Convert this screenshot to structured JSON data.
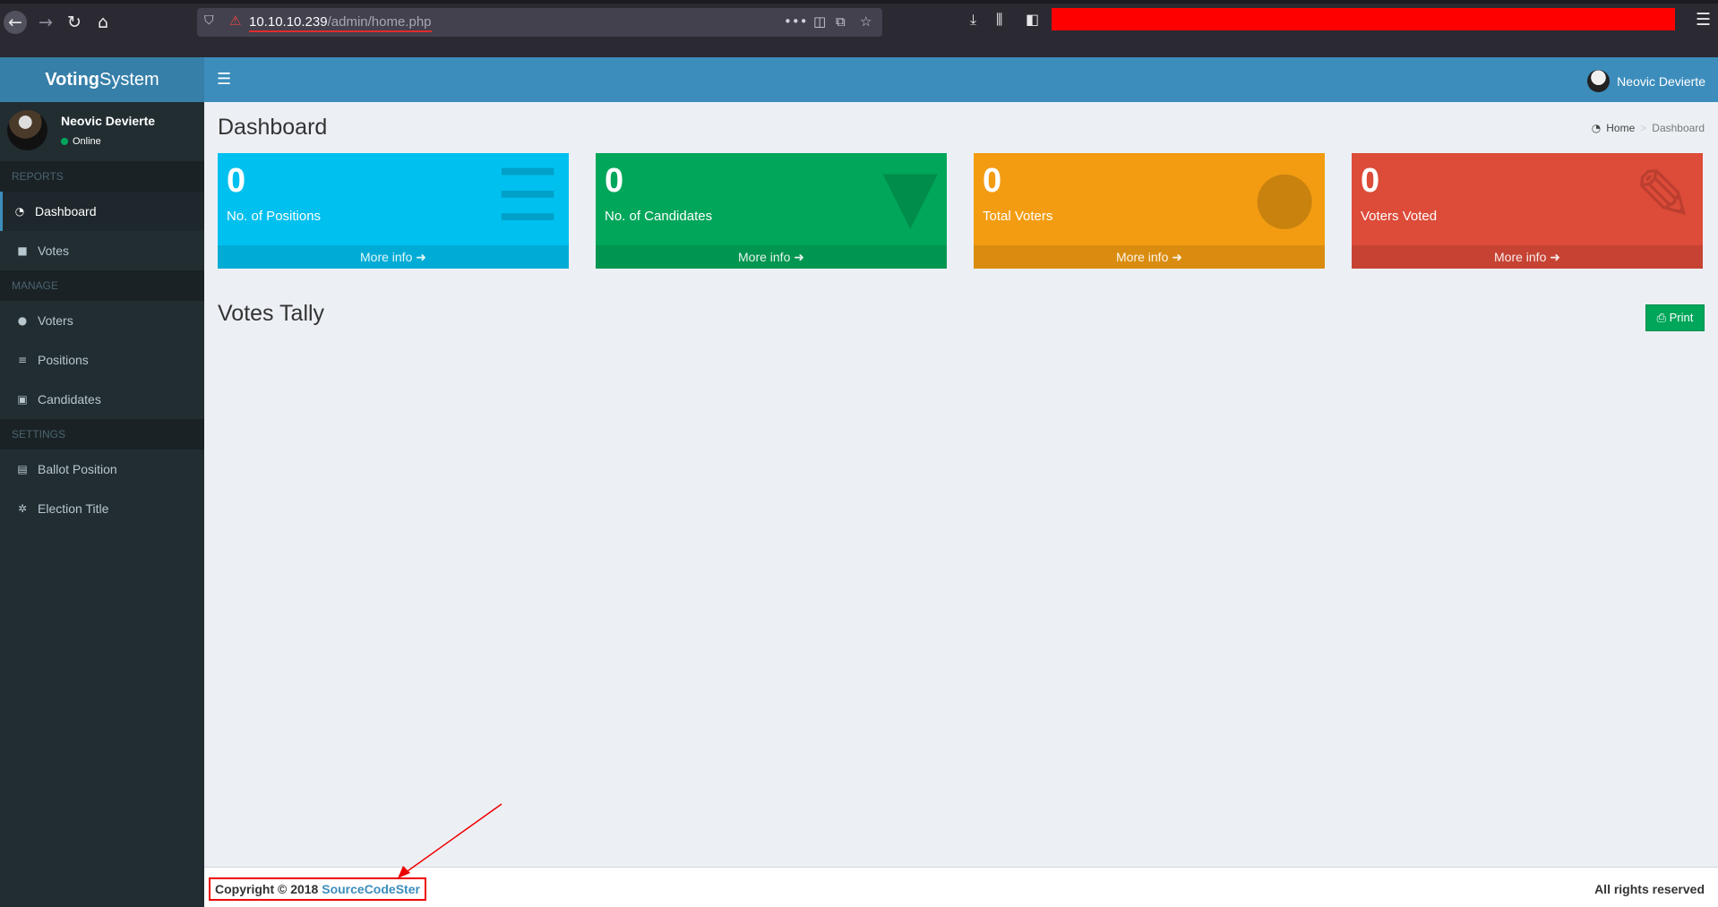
{
  "browser": {
    "url_host": "10.10.10.239",
    "url_path": "/admin/home.php"
  },
  "app": {
    "logo_bold": "Voting",
    "logo_rest": "System"
  },
  "header": {
    "user_name": "Neovic Devierte"
  },
  "sidebar": {
    "user_name": "Neovic Devierte",
    "status": "Online",
    "sections": [
      {
        "title": "REPORTS",
        "items": [
          {
            "label": "Dashboard",
            "icon": "dashboard-icon"
          },
          {
            "label": "Votes",
            "icon": "lock-icon"
          }
        ]
      },
      {
        "title": "MANAGE",
        "items": [
          {
            "label": "Voters",
            "icon": "users-icon"
          },
          {
            "label": "Positions",
            "icon": "tasks-icon"
          },
          {
            "label": "Candidates",
            "icon": "black-tie-icon"
          }
        ]
      },
      {
        "title": "SETTINGS",
        "items": [
          {
            "label": "Ballot Position",
            "icon": "file-text-icon"
          },
          {
            "label": "Election Title",
            "icon": "cog-icon"
          }
        ]
      }
    ]
  },
  "content": {
    "title": "Dashboard",
    "breadcrumb": {
      "home": "Home",
      "current": "Dashboard"
    },
    "boxes": [
      {
        "value": "0",
        "label": "No. of Positions",
        "more": "More info",
        "color": "#00c0ef",
        "icon": "tasks-icon"
      },
      {
        "value": "0",
        "label": "No. of Candidates",
        "more": "More info",
        "color": "#00a65a",
        "icon": "black-tie-icon"
      },
      {
        "value": "0",
        "label": "Total Voters",
        "more": "More info",
        "color": "#f39c12",
        "icon": "users-icon"
      },
      {
        "value": "0",
        "label": "Voters Voted",
        "more": "More info",
        "color": "#dd4b39",
        "icon": "edit-icon"
      }
    ],
    "tally_title": "Votes Tally",
    "print_label": "Print"
  },
  "footer": {
    "copyright_prefix": "Copyright © 2018",
    "brand": "SourceCodeSter",
    "rights": "All rights reserved"
  }
}
